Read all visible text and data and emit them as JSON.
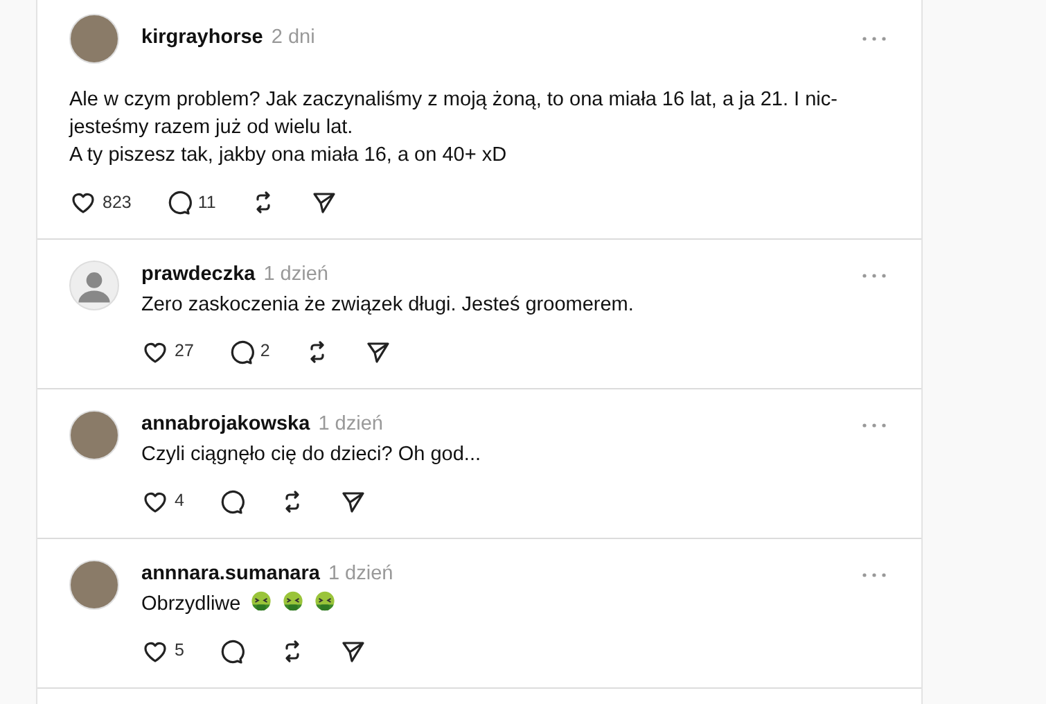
{
  "posts": [
    {
      "kind": "post",
      "username": "kirgrayhorse",
      "time": "2 dni",
      "avatar": {
        "kind": "photo"
      },
      "paragraphs": [
        "Ale w czym problem? Jak zaczynaliśmy z moją żoną, to ona miała 16 lat, a ja 21. I nic-jesteśmy razem już od wielu lat.",
        "A ty piszesz tak, jakby ona miała 16, a on 40+ xD"
      ],
      "likes": "823",
      "replies": "11"
    },
    {
      "kind": "reply",
      "username": "prawdeczka",
      "time": "1 dzień",
      "avatar": {
        "kind": "default"
      },
      "paragraphs": [
        "Zero zaskoczenia że związek długi. Jesteś groomerem."
      ],
      "likes": "27",
      "replies": "2"
    },
    {
      "kind": "reply",
      "username": "annabrojakowska",
      "time": "1 dzień",
      "avatar": {
        "kind": "photo"
      },
      "paragraphs": [
        "Czyli ciągnęło cię do dzieci? Oh god..."
      ],
      "likes": "4"
    },
    {
      "kind": "reply",
      "username": "annnara.sumanara",
      "time": "1 dzień",
      "avatar": {
        "kind": "photo"
      },
      "paragraphs": [
        "Obrzydliwe"
      ],
      "emoji": [
        {
          "kind": "nauseated"
        },
        {
          "kind": "nauseated"
        },
        {
          "kind": "nauseated"
        }
      ],
      "likes": "5"
    }
  ]
}
